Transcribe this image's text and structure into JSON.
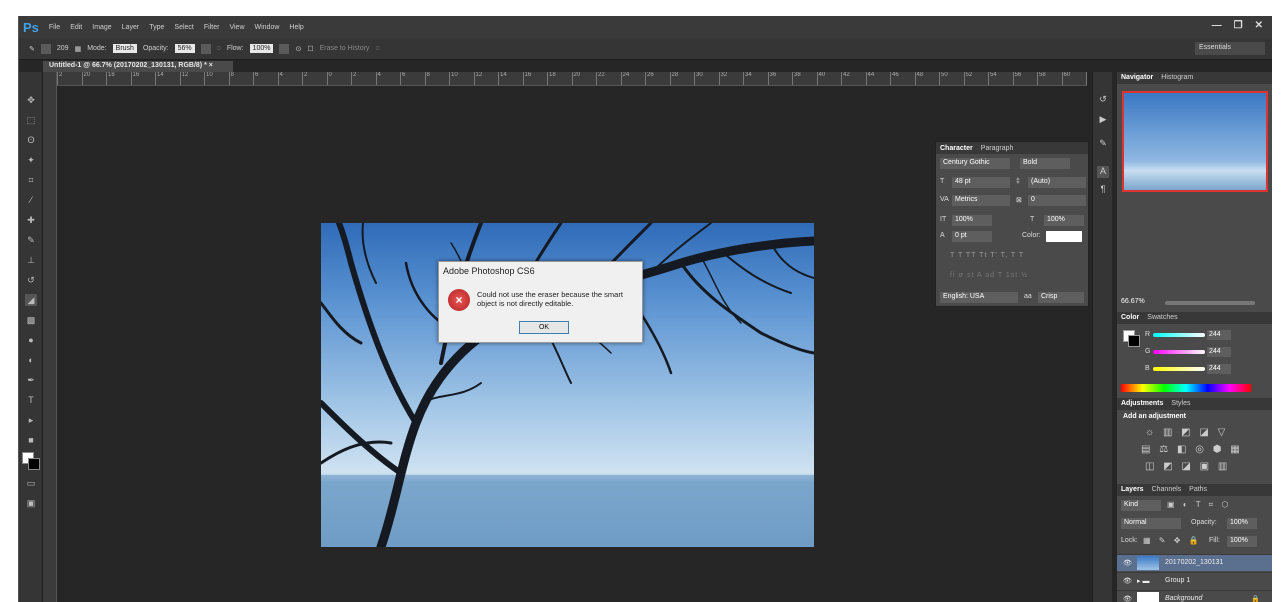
{
  "app": {
    "logo": "Ps"
  },
  "menubar": {
    "items": [
      "File",
      "Edit",
      "Image",
      "Layer",
      "Type",
      "Select",
      "Filter",
      "View",
      "Window",
      "Help"
    ]
  },
  "window_controls": {
    "minimize": "—",
    "maximize": "❐",
    "close": "✕"
  },
  "options": {
    "brush_size": "209",
    "mode_label": "Mode:",
    "mode_value": "Brush",
    "opacity_label": "Opacity:",
    "opacity_value": "56%",
    "flow_label": "Flow:",
    "flow_value": "100%",
    "erase_history": "Erase to History"
  },
  "workspace": {
    "value": "Essentials"
  },
  "document": {
    "tab_title": "Untitled-1 @ 66.7% (20170202_130131, RGB/8) * ",
    "tab_close": "×"
  },
  "ruler": {
    "h_ticks": [
      "2",
      "20",
      "18",
      "16",
      "14",
      "12",
      "10",
      "8",
      "6",
      "4",
      "2",
      "0",
      "2",
      "4",
      "6",
      "8",
      "10",
      "12",
      "14",
      "16",
      "18",
      "20",
      "22",
      "24",
      "26",
      "28",
      "30",
      "32",
      "34",
      "36",
      "38",
      "40",
      "42",
      "44",
      "46",
      "48",
      "50",
      "52",
      "54",
      "56",
      "58",
      "60",
      "62"
    ]
  },
  "dialog": {
    "title": "Adobe Photoshop CS6",
    "icon": "×",
    "message": "Could not use the eraser because the smart object is not directly editable.",
    "ok": "OK"
  },
  "character_panel": {
    "tabs": [
      "Character",
      "Paragraph"
    ],
    "font_family": "Century Gothic",
    "font_style": "Bold",
    "size": "48 pt",
    "leading": "(Auto)",
    "kerning": "Metrics",
    "tracking": "0",
    "vscale": "100%",
    "hscale": "100%",
    "baseline": "0 pt",
    "color_label": "Color:",
    "language": "English: USA",
    "aa_label": "aa",
    "antialias": "Crisp",
    "style_buttons": "T  T  TT  Tt  T'  T,  T  T",
    "glyph_buttons": "fi  ơ  st  A  ad  T  1st  ½"
  },
  "navigator": {
    "tabs": [
      "Navigator",
      "Histogram"
    ],
    "zoom": "66.67%"
  },
  "color_panel": {
    "tabs": [
      "Color",
      "Swatches"
    ],
    "r_label": "R",
    "g_label": "G",
    "b_label": "B",
    "r": "244",
    "g": "244",
    "b": "244"
  },
  "adjustments": {
    "tabs": [
      "Adjustments",
      "Styles"
    ],
    "heading": "Add an adjustment"
  },
  "layers": {
    "tabs": [
      "Layers",
      "Channels",
      "Paths"
    ],
    "kind": "Kind",
    "blend_mode": "Normal",
    "opacity_label": "Opacity:",
    "opacity": "100%",
    "lock_label": "Lock:",
    "fill_label": "Fill:",
    "fill": "100%",
    "items": [
      {
        "name": "20170202_130131"
      },
      {
        "name": "Group 1"
      },
      {
        "name": "Background"
      }
    ]
  }
}
